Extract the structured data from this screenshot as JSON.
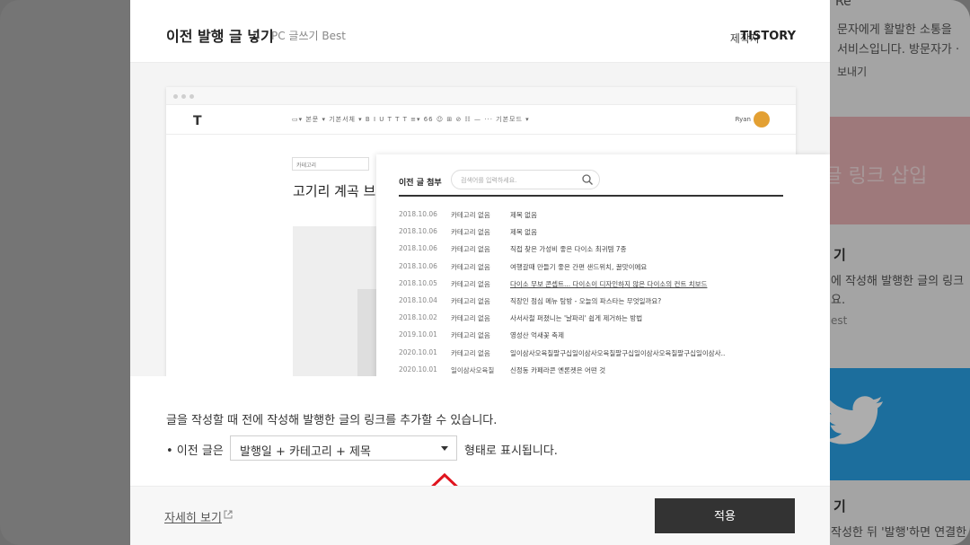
{
  "background": {
    "top_text": "Re",
    "line1": "문자에게 활발한 소통을",
    "line2": "서비스입니다. 방문자가 ·",
    "line3": "보내기",
    "pink_text": "행 글 링크 삽입",
    "heading1": "기",
    "para1": "에 작성해 발행한 글의 링크",
    "para2": "요.",
    "tag": "est",
    "heading2": "기",
    "para3": "작성한 뒤 '발행'하면 연결한"
  },
  "modal": {
    "title": "이전 발행 글 넣기",
    "subtitle": "PC 글쓰기 Best",
    "maker_label": "제작자",
    "maker_name": "TISTORY"
  },
  "editor": {
    "logo": "T",
    "toolbar_text": "▭▾  본문 ▾   기본서체 ▾    B  I  U  T  T  T    ≡▾    66  ☺  ⊞  ⊘  ☷  —  ···       기본모드 ▾",
    "user_name": "Ryan",
    "category": "카테고리",
    "post_title": "고기리 계곡 브런"
  },
  "attach": {
    "title": "이전 글 첨부",
    "search_placeholder": "검색어를 입력하세요.",
    "rows": [
      {
        "date": "2018.10.06",
        "category": "카테고리 없음",
        "title": "제목 없음"
      },
      {
        "date": "2018.10.06",
        "category": "카테고리 없음",
        "title": "제목 없음"
      },
      {
        "date": "2018.10.06",
        "category": "카테고리 없음",
        "title": "직접 찾은 가성비 좋은 다이소 최귀템 7종"
      },
      {
        "date": "2018.10.06",
        "category": "카테고리 없음",
        "title": "여행갈때 만들기 좋은 간편 샌드위치, 꿀맛이에요"
      },
      {
        "date": "2018.10.05",
        "category": "카테고리 없음",
        "title": "다이소 무보 콘셉트... 다이소이 디자인하지 않은 다이소의 컨트 치보드"
      },
      {
        "date": "2018.10.04",
        "category": "카테고리 없음",
        "title": "직장인 점심 메뉴 탐방 - 오늘의 파스타는 무엇일까요?"
      },
      {
        "date": "2018.10.02",
        "category": "카테고리 없음",
        "title": "사서사철 퍼졌니는 '날파리' 쉽게 제거하는 방법"
      },
      {
        "date": "2019.10.01",
        "category": "카테고리 없음",
        "title": "영성산 억새꽃 축제"
      },
      {
        "date": "2020.10.01",
        "category": "카테고리 없음",
        "title": "일이삼사오육칠팔구십일이삼사오육칠팔구십일이삼사오육칠팔구십일이삼사.."
      },
      {
        "date": "2020.10.01",
        "category": "일이삼사오육칠",
        "title": "신정동 카페라콘 옌론켓은 어떤 것"
      }
    ]
  },
  "description": "글을 작성할 때 전에 작성해 발행한 글의 링크를 추가할 수 있습니다.",
  "format": {
    "prefix": "• 이전 글은",
    "selected": "발행일 + 카테고리 + 제목",
    "suffix": "형태로 표시됩니다."
  },
  "footer": {
    "detail_link": "자세히 보기",
    "apply": "적용"
  },
  "colors": {
    "apply_button": "#333333",
    "arrow": "#e0141e",
    "twitter": "#2aa3e7"
  }
}
